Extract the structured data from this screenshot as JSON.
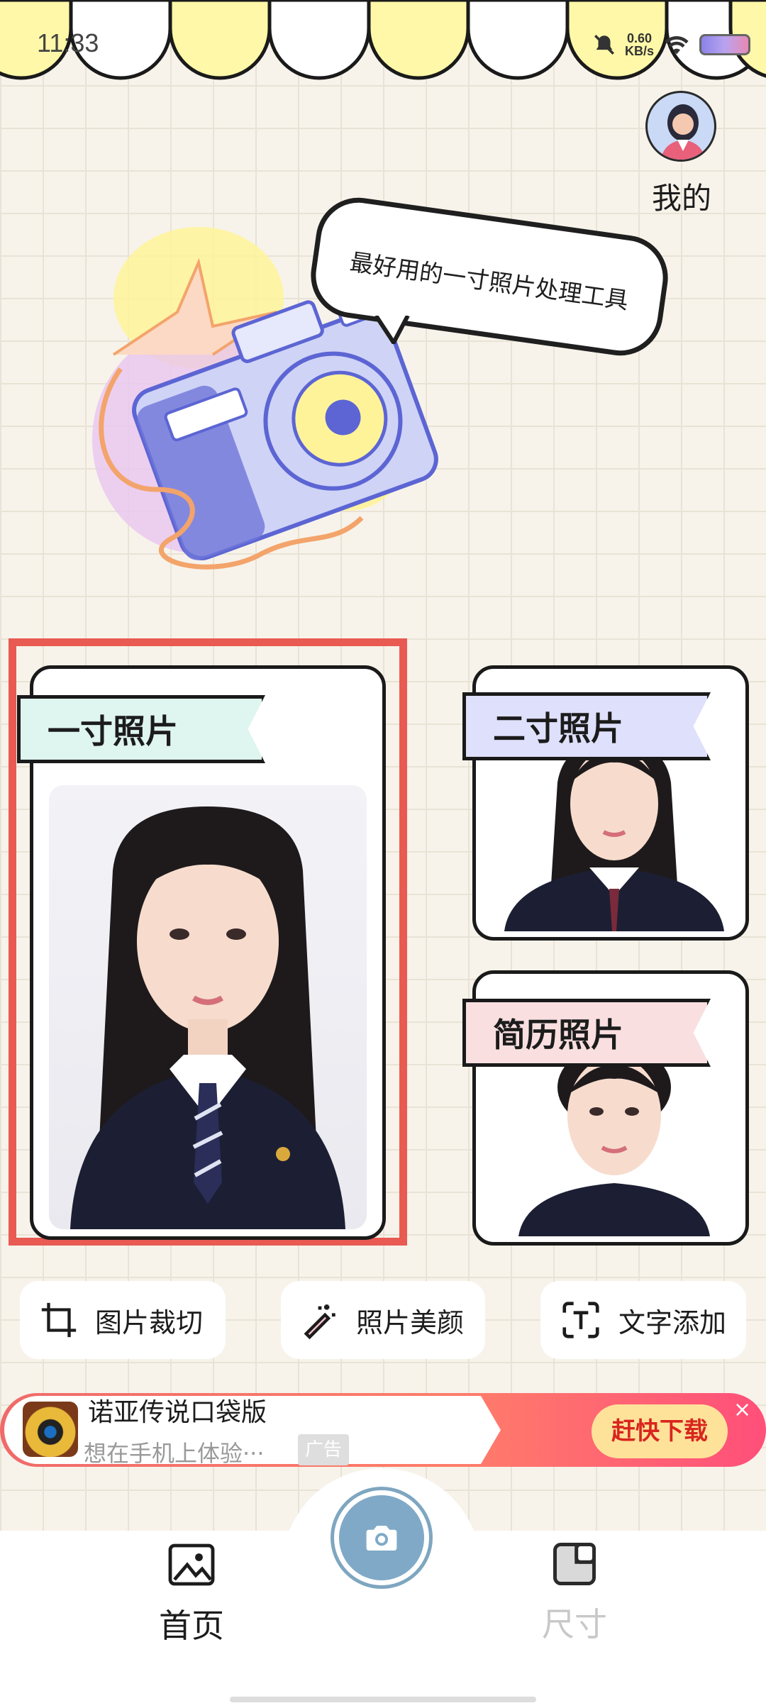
{
  "status_bar": {
    "time": "11:33",
    "net_speed_value": "0.60",
    "net_speed_unit": "KB/s"
  },
  "header": {
    "mine_label": "我的"
  },
  "hero": {
    "slogan": "最好用的一寸照片处理工具"
  },
  "cards": {
    "one_inch": "一寸照片",
    "two_inch": "二寸照片",
    "resume": "简历照片"
  },
  "tools": [
    {
      "label": "图片裁切",
      "icon": "crop-icon"
    },
    {
      "label": "照片美颜",
      "icon": "magic-wand-icon"
    },
    {
      "label": "文字添加",
      "icon": "text-icon"
    }
  ],
  "ad": {
    "title": "诺亚传说口袋版",
    "subtitle": "想在手机上体验···",
    "tag": "广告",
    "cta": "赶快下载",
    "close": "×"
  },
  "nav": {
    "home": "首页",
    "size": "尺寸"
  },
  "colors": {
    "accent": "#e85a52",
    "nav_active": "#1c1c1c",
    "nav_inactive": "#c8c8c8",
    "camera": "#7fa9c7"
  }
}
